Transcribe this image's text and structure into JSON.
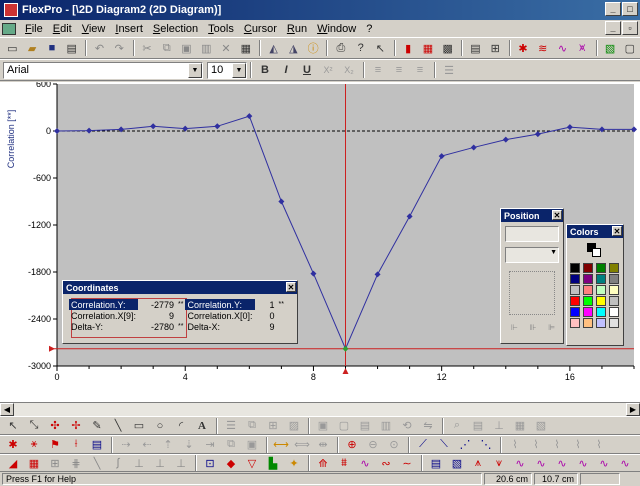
{
  "window": {
    "title": "FlexPro - [\\2D Diagram2 (2D Diagram)]"
  },
  "menu": {
    "items": [
      "File",
      "Edit",
      "View",
      "Insert",
      "Selection",
      "Tools",
      "Cursor",
      "Run",
      "Window",
      "?"
    ]
  },
  "format_toolbar": {
    "font_name": "Arial",
    "font_size": "10",
    "bold": "B",
    "italic": "I",
    "underline": "U"
  },
  "chart_data": {
    "type": "line",
    "ylabel": "Correlation [**]",
    "xlim": [
      0,
      18
    ],
    "ylim": [
      -3000,
      600
    ],
    "x_ticks": [
      0,
      4,
      8,
      12,
      16
    ],
    "y_ticks": [
      600,
      0,
      -600,
      -1200,
      -1800,
      -2400,
      -3000
    ],
    "series": [
      {
        "x": [
          0,
          1,
          2,
          3,
          4,
          5,
          6,
          7,
          8,
          9,
          10,
          11,
          12,
          13,
          14,
          15,
          16,
          17,
          18
        ],
        "values": [
          0,
          5,
          20,
          60,
          30,
          60,
          190,
          -900,
          -1820,
          -2779,
          -1830,
          -1090,
          -320,
          -210,
          -110,
          -40,
          50,
          20,
          20
        ]
      }
    ],
    "cursor_x": 9,
    "cursor_y": -2780,
    "grid": false,
    "colors": {
      "plot_bg": "#c0c0c0",
      "line": "#3030a0",
      "cursor": "#cc2020",
      "marker_highlight": "#30a030"
    }
  },
  "coordinates_panel": {
    "title": "Coordinates",
    "rows": [
      {
        "label1": "Correlation.Y:",
        "value1": "-2779",
        "unit1": "**",
        "label2": "Correlation.Y:",
        "value2": "1",
        "unit2": "**"
      },
      {
        "label1": "Correlation.X[9]:",
        "value1": "9",
        "unit1": "",
        "label2": "Correlation.X[0]:",
        "value2": "0",
        "unit2": ""
      },
      {
        "label1": "Delta-Y:",
        "value1": "-2780",
        "unit1": "**",
        "label2": "Delta-X:",
        "value2": "9",
        "unit2": ""
      }
    ]
  },
  "position_panel": {
    "title": "Position"
  },
  "colors_panel": {
    "title": "Colors",
    "palette": [
      "#000000",
      "#800000",
      "#008000",
      "#808000",
      "#000080",
      "#800080",
      "#008080",
      "#808080",
      "#c0c0c0",
      "#ff8080",
      "#c0ffc0",
      "#ffffc0",
      "#ff0000",
      "#00ff00",
      "#ffff00",
      "#c0c0c0",
      "#0000ff",
      "#ff00ff",
      "#00ffff",
      "#ffffff",
      "#ffc0c0",
      "#ffc080",
      "#c0c0ff",
      "#e0e0e0"
    ]
  },
  "statusbar": {
    "message": "Press F1 for Help",
    "pos_x": "20.6 cm",
    "pos_y": "10.7 cm"
  }
}
